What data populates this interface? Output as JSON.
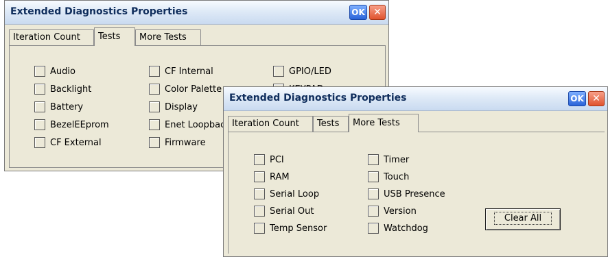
{
  "back_dialog": {
    "title": "Extended Diagnostics Properties",
    "ok_label": "OK",
    "close_label": "✕",
    "tabs": [
      {
        "label": "Iteration Count"
      },
      {
        "label": "Tests"
      },
      {
        "label": "More Tests"
      }
    ],
    "selected_tab": "Tests",
    "checkboxes": [
      {
        "label": "Audio",
        "checked": false
      },
      {
        "label": "Backlight",
        "checked": false
      },
      {
        "label": "Battery",
        "checked": false
      },
      {
        "label": "BezelEEprom",
        "checked": false
      },
      {
        "label": "CF External",
        "checked": false
      },
      {
        "label": "CF Internal",
        "checked": false
      },
      {
        "label": "Color Palette",
        "checked": false
      },
      {
        "label": "Display",
        "checked": false
      },
      {
        "label": "Enet Loopbac",
        "checked": false
      },
      {
        "label": "Firmware",
        "checked": false
      },
      {
        "label": "GPIO/LED",
        "checked": false
      },
      {
        "label": "KEYPAD",
        "checked": false
      }
    ]
  },
  "front_dialog": {
    "title": "Extended Diagnostics Properties",
    "ok_label": "OK",
    "close_label": "✕",
    "tabs": [
      {
        "label": "Iteration Count"
      },
      {
        "label": "Tests"
      },
      {
        "label": "More Tests"
      }
    ],
    "selected_tab": "More Tests",
    "checkboxes": [
      {
        "label": "PCI",
        "checked": false
      },
      {
        "label": "RAM",
        "checked": false
      },
      {
        "label": "Serial Loop",
        "checked": false
      },
      {
        "label": "Serial Out",
        "checked": false
      },
      {
        "label": "Temp Sensor",
        "checked": false
      },
      {
        "label": "Timer",
        "checked": false
      },
      {
        "label": "Touch",
        "checked": false
      },
      {
        "label": "USB Presence",
        "checked": false
      },
      {
        "label": "Version",
        "checked": false
      },
      {
        "label": "Watchdog",
        "checked": false
      }
    ],
    "clear_all_label": "Clear All"
  }
}
